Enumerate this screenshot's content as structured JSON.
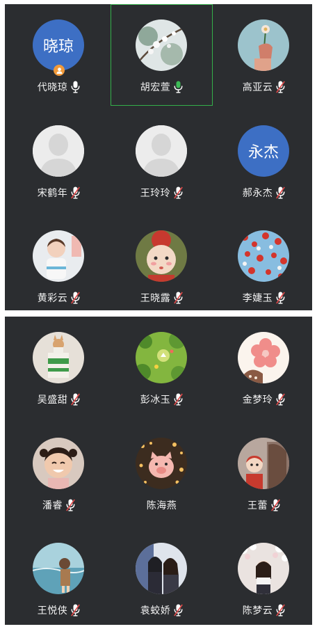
{
  "participants": [
    {
      "name": "代晓琼",
      "mic": "on",
      "avatar": "text",
      "avatar_text": "晓琼",
      "host": true
    },
    {
      "name": "胡宏萱",
      "mic": "speaking",
      "avatar": "photo-blossom",
      "active": true
    },
    {
      "name": "高亚云",
      "mic": "muted",
      "avatar": "photo-flower-hand"
    },
    {
      "name": "宋鹤年",
      "mic": "muted",
      "avatar": "default"
    },
    {
      "name": "王玲玲",
      "mic": "muted",
      "avatar": "default"
    },
    {
      "name": "郝永杰",
      "mic": "muted",
      "avatar": "text",
      "avatar_text": "永杰"
    },
    {
      "name": "黄彩云",
      "mic": "muted",
      "avatar": "photo-child"
    },
    {
      "name": "王晓露",
      "mic": "muted",
      "avatar": "photo-cartoon-girl"
    },
    {
      "name": "李婕玉",
      "mic": "muted",
      "avatar": "photo-red-leaves"
    },
    {
      "name": "吴盛甜",
      "mic": "muted",
      "avatar": "photo-cat-box"
    },
    {
      "name": "彭冰玉",
      "mic": "muted",
      "avatar": "photo-green-game"
    },
    {
      "name": "金梦玲",
      "mic": "muted",
      "avatar": "photo-pink-flower"
    },
    {
      "name": "潘睿",
      "mic": "muted",
      "avatar": "photo-kid-smile"
    },
    {
      "name": "陈海燕",
      "mic": "none",
      "avatar": "photo-pig-lights"
    },
    {
      "name": "王蕾",
      "mic": "muted",
      "avatar": "photo-girl-mirror"
    },
    {
      "name": "王悦侠",
      "mic": "muted",
      "avatar": "photo-anime-sea"
    },
    {
      "name": "袁蛟娇",
      "mic": "muted",
      "avatar": "photo-two-people"
    },
    {
      "name": "陈梦云",
      "mic": "muted",
      "avatar": "photo-girl-blossom"
    }
  ],
  "colors": {
    "panel": "#2b2d30",
    "mic_active": "#3dbb57",
    "mute_slash": "#e04848",
    "highlight_border": "#34b04a",
    "text_avatar": "#3d6fc4",
    "host_badge": "#f29a3a"
  }
}
